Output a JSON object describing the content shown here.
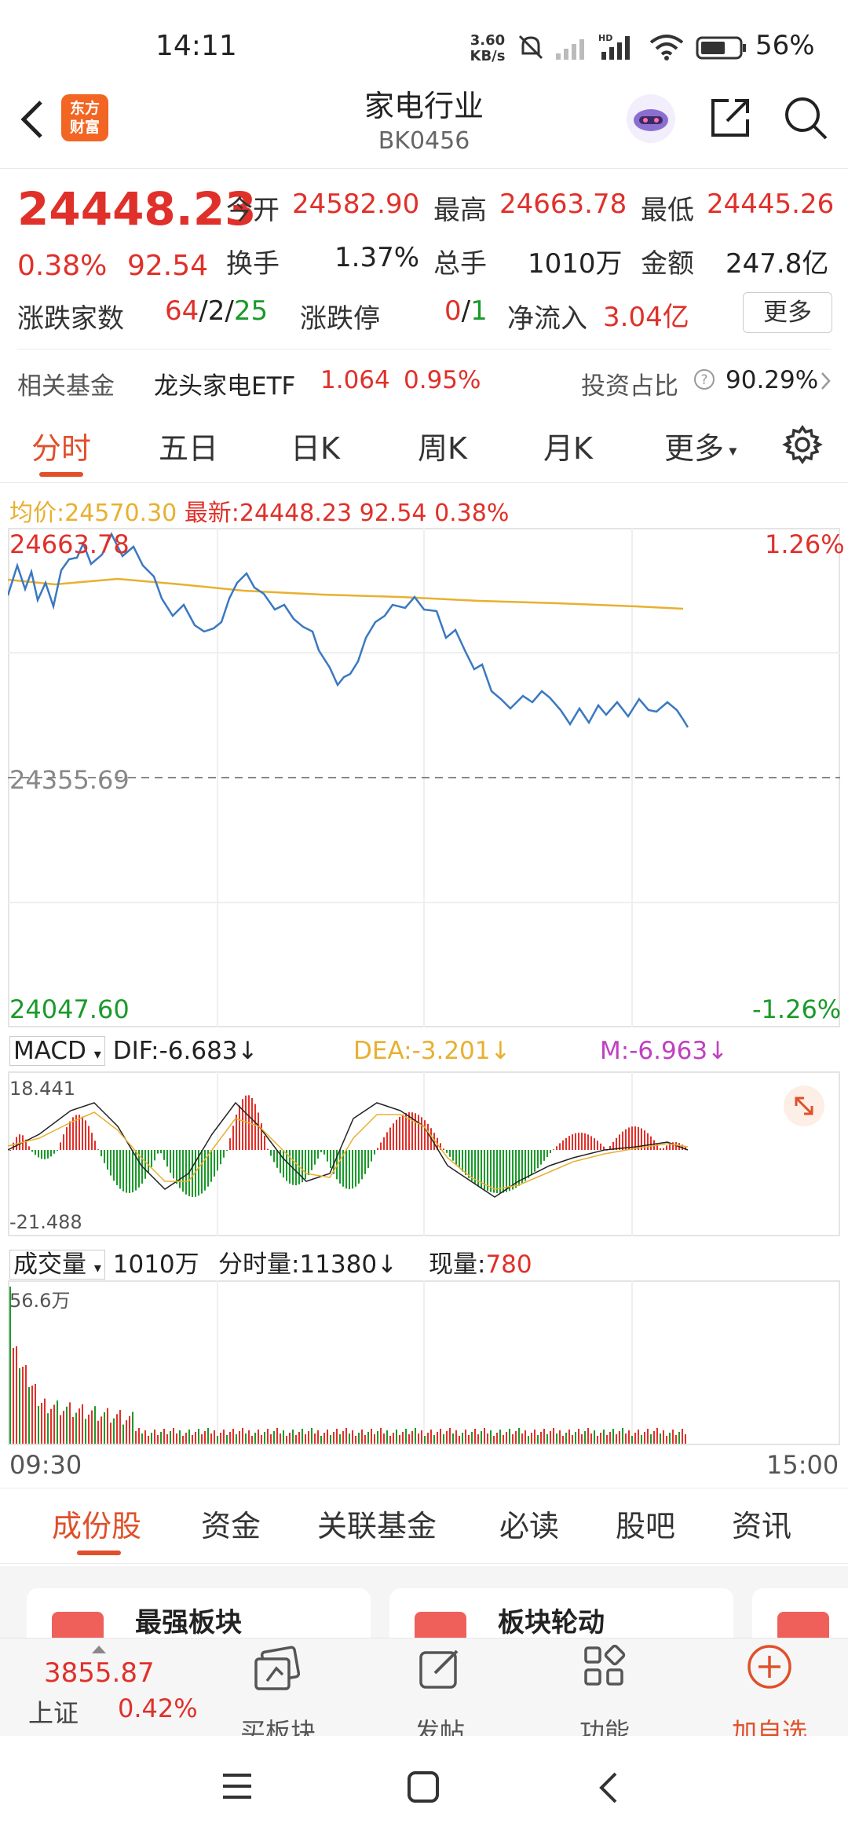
{
  "status": {
    "time": "14:11",
    "net_speed_1": "3.60",
    "net_speed_2": "KB/s",
    "battery": "56%"
  },
  "header": {
    "title": "家电行业",
    "code": "BK0456",
    "logo_line1": "东方",
    "logo_line2": "财富"
  },
  "quote": {
    "price": "24448.23",
    "change_pct": "0.38%",
    "change": "92.54",
    "open_label": "今开",
    "open": "24582.90",
    "high_label": "最高",
    "high": "24663.78",
    "low_label": "最低",
    "low": "24445.26",
    "turnover_label": "换手",
    "turnover": "1.37%",
    "volume_label": "总手",
    "volume": "1010万",
    "amount_label": "金额",
    "amount": "247.8亿",
    "breadth_label": "涨跌家数",
    "breadth_up": "64",
    "breadth_sep1": "/",
    "breadth_flat": "2",
    "breadth_sep2": "/",
    "breadth_down": "25",
    "limit_label": "涨跌停",
    "limit_up": "0",
    "limit_sep": "/",
    "limit_down": "1",
    "inflow_label": "净流入",
    "inflow": "3.04亿",
    "more": "更多"
  },
  "fund": {
    "label": "相关基金",
    "name": "龙头家电ETF",
    "price": "1.064",
    "pct": "0.95%",
    "ratio_label": "投资占比",
    "ratio": "90.29%"
  },
  "tabs": [
    "分时",
    "五日",
    "日K",
    "周K",
    "月K",
    "更多"
  ],
  "chart": {
    "avg_label": "均价:",
    "avg": "24570.30",
    "last_label": "最新:",
    "last": "24448.23",
    "last_chg": "92.54",
    "last_pct": "0.38%",
    "y_top": "24663.78",
    "y_mid": "24355.69",
    "y_bot": "24047.60",
    "pct_top": "1.26%",
    "pct_bot": "-1.26%",
    "time_start": "09:30",
    "time_end": "15:00"
  },
  "macd": {
    "label": "MACD",
    "dif": "DIF:-6.683",
    "dea": "DEA:-3.201",
    "m": "M:-6.963",
    "top": "18.441",
    "bottom": "-21.488"
  },
  "volume": {
    "label": "成交量",
    "total": "1010万",
    "minute": "分时量:11380",
    "now_label": "现量:",
    "now": "780",
    "max": "56.6万"
  },
  "subtabs": [
    "成份股",
    "资金",
    "关联基金",
    "必读",
    "股吧",
    "资讯"
  ],
  "cards": [
    "最强板块",
    "板块轮动"
  ],
  "bottom": {
    "index_value": "3855.87",
    "index_name": "上证",
    "index_pct": "0.42%",
    "buy": "买板块",
    "post": "发帖",
    "func": "功能",
    "add": "加自选"
  },
  "chart_data": {
    "type": "line",
    "x_range": [
      "09:30",
      "15:00"
    ],
    "ylim": [
      24047.6,
      24663.78
    ],
    "prev_close": 24355.69,
    "series": [
      {
        "name": "最新",
        "x": [
          "09:30",
          "09:40",
          "09:50",
          "10:00",
          "10:10",
          "10:20",
          "10:30",
          "10:40",
          "10:50",
          "11:00",
          "11:10",
          "11:20",
          "11:30",
          "13:10",
          "13:20",
          "13:30",
          "13:40",
          "13:50",
          "14:00",
          "14:10",
          "14:20",
          "14:30",
          "14:40",
          "14:50",
          "15:00"
        ],
        "values": [
          24595,
          24640,
          24655,
          24615,
          24545,
          24530,
          24600,
          24590,
          24555,
          24480,
          24495,
          24560,
          24570,
          24540,
          24480,
          24455,
          24460,
          24435,
          24460,
          24475,
          24465,
          24470,
          24465,
          24460,
          24448.23
        ]
      },
      {
        "name": "均价",
        "values": [
          24625,
          24632,
          24628,
          24615,
          24605,
          24600,
          24598,
          24595,
          24592,
          24590,
          24588,
          24585,
          24582,
          24580,
          24578,
          24576,
          24575,
          24574,
          24573,
          24572,
          24571,
          24571,
          24570,
          24570,
          24570.3
        ]
      }
    ]
  }
}
